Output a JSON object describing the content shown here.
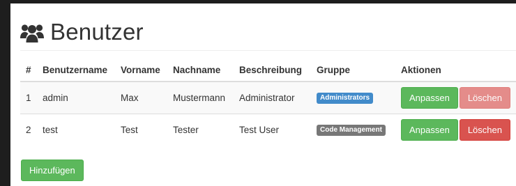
{
  "page": {
    "title": "Benutzer",
    "icon": "users-icon"
  },
  "table": {
    "headers": [
      "#",
      "Benutzername",
      "Vorname",
      "Nachname",
      "Beschreibung",
      "Gruppe",
      "Aktionen"
    ],
    "rows": [
      {
        "num": "1",
        "username": "admin",
        "first": "Max",
        "last": "Mustermann",
        "desc": "Administrator",
        "group": "Administrators",
        "group_color": "#428bca",
        "edit": "Anpassen",
        "delete": "Löschen",
        "delete_disabled": true
      },
      {
        "num": "2",
        "username": "test",
        "first": "Test",
        "last": "Tester",
        "desc": "Test User",
        "group": "Code Management",
        "group_color": "#777777",
        "edit": "Anpassen",
        "delete": "Löschen",
        "delete_disabled": false
      }
    ]
  },
  "add_button": "Hinzufügen",
  "colors": {
    "success": "#5cb85c",
    "danger": "#d9534f",
    "primary": "#428bca",
    "default": "#777777"
  }
}
